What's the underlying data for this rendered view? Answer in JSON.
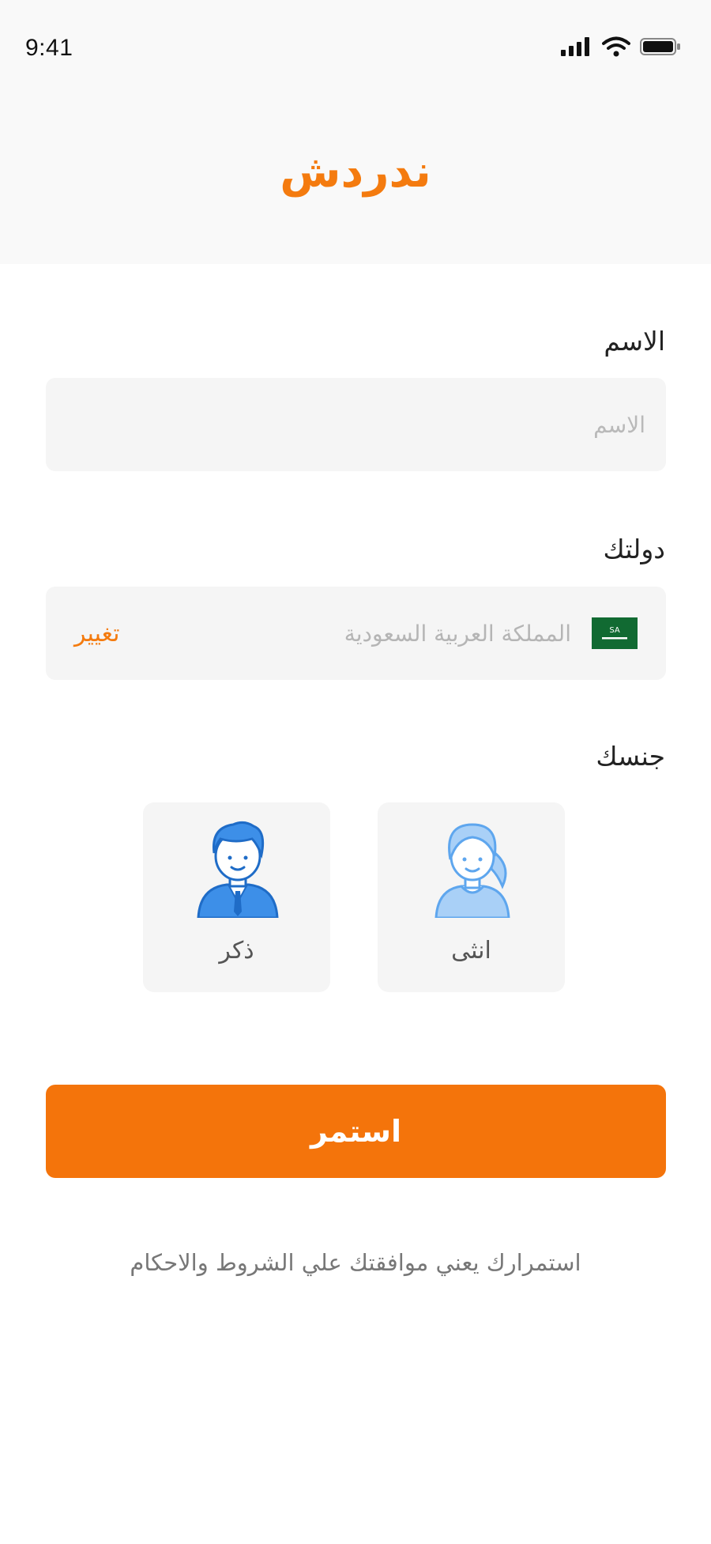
{
  "status_bar": {
    "time": "9:41",
    "icons": [
      "signal-icon",
      "wifi-icon",
      "battery-icon"
    ]
  },
  "header": {
    "title": "ندردش"
  },
  "form": {
    "name": {
      "label": "الاسم",
      "placeholder": "الاسم",
      "value": ""
    },
    "country": {
      "label": "دولتك",
      "flag_text": "SA",
      "value": "المملكة العربية السعودية",
      "change_label": "تغيير"
    },
    "gender": {
      "label": "جنسك",
      "female_label": "انثى",
      "male_label": "ذكر"
    }
  },
  "actions": {
    "continue_label": "استمر"
  },
  "footer": {
    "terms": "استمرارك يعني موافقتك علي الشروط والاحكام"
  },
  "colors": {
    "accent": "#f47b0f",
    "button": "#f4740b",
    "field_bg": "#f5f5f5",
    "avatar_blue": "#3d8fe8"
  }
}
